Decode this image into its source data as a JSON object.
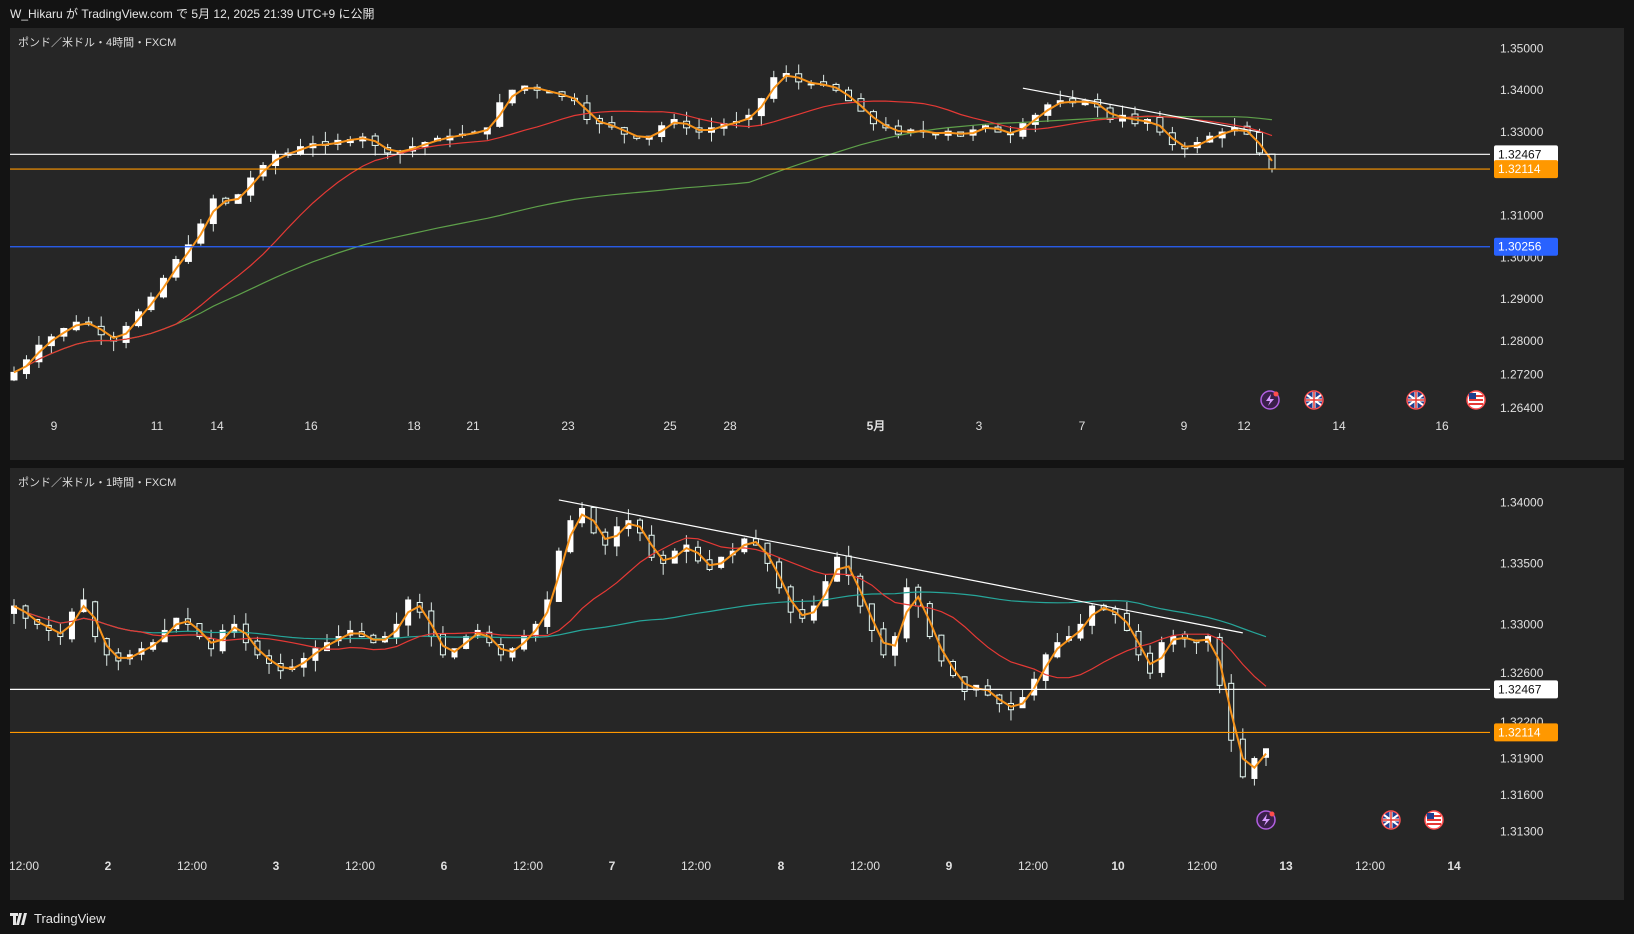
{
  "header": {
    "text": "W_Hikaru が TradingView.com で 5月 12, 2025 21:39 UTC+9 に公開"
  },
  "footer": {
    "brand": "TradingView"
  },
  "colors": {
    "pane_bg": "#262626",
    "candle_up": "#ffffff",
    "candle_down": "#e8fcf6",
    "ma_short": "#f7931a",
    "ma_mid": "#e53935",
    "ma_long_4h": "#5ea04a",
    "ma_long_1h": "#26a69a",
    "resistance": "#ffffff",
    "support_white": "#ffffff",
    "support_orange": "#ff9800",
    "support_blue": "#2962ff",
    "trendline": "#ffffff"
  },
  "panes": [
    {
      "id": "4h",
      "title": "ポンド／米ドル・4時間・FXCM",
      "chart_data": {
        "type": "candlestick",
        "instrument": "GBP/USD",
        "timeframe": "4h",
        "y_ticks": [
          "1.35000",
          "1.34000",
          "1.33000",
          "1.32000",
          "1.31000",
          "1.30000",
          "1.29000",
          "1.28000",
          "1.27200",
          "1.26400"
        ],
        "x_ticks": [
          "9",
          "11",
          "14",
          "16",
          "18",
          "21",
          "23",
          "25",
          "28",
          "5月",
          "3",
          "7",
          "9",
          "12",
          "14",
          "16"
        ],
        "ylim": [
          1.2635,
          1.3525
        ],
        "close_path": [
          1.2725,
          1.2755,
          1.279,
          1.281,
          1.283,
          1.2845,
          1.284,
          1.2815,
          1.28,
          1.2835,
          1.287,
          1.2905,
          1.295,
          1.2995,
          1.303,
          1.308,
          1.314,
          1.313,
          1.315,
          1.319,
          1.322,
          1.3245,
          1.325,
          1.3265,
          1.3272,
          1.3268,
          1.328,
          1.3282,
          1.3288,
          1.3268,
          1.325,
          1.3255,
          1.3265,
          1.3275,
          1.3285,
          1.329,
          1.3295,
          1.33,
          1.331,
          1.337,
          1.34,
          1.341,
          1.34,
          1.3395,
          1.3385,
          1.3375,
          1.333,
          1.332,
          1.3312,
          1.3295,
          1.3285,
          1.329,
          1.3315,
          1.333,
          1.331,
          1.33,
          1.331,
          1.332,
          1.3325,
          1.334,
          1.338,
          1.343,
          1.344,
          1.342,
          1.3415,
          1.3412,
          1.34,
          1.3375,
          1.335,
          1.332,
          1.331,
          1.3295,
          1.3305,
          1.33,
          1.3295,
          1.3302,
          1.329,
          1.3305,
          1.3315,
          1.33,
          1.3295,
          1.332,
          1.334,
          1.3365,
          1.3375,
          1.337,
          1.3375,
          1.336,
          1.333,
          1.334,
          1.332,
          1.333,
          1.33,
          1.327,
          1.326,
          1.3275,
          1.329,
          1.33,
          1.331,
          1.3295,
          1.325,
          1.3212
        ],
        "levels": [
          {
            "label": "1.32467",
            "value": 1.32467,
            "style": "white"
          },
          {
            "label": "1.32114",
            "value": 1.32114,
            "style": "orange"
          },
          {
            "label": "1.30256",
            "value": 1.30256,
            "style": "blue"
          }
        ],
        "trendline": {
          "from": [
            1.3405,
            1.3402
          ],
          "to": [
            1.3305,
            1.33
          ]
        },
        "events": [
          {
            "icon": "lightning-icon"
          },
          {
            "icon": "uk-flag-icon"
          },
          {
            "icon": "uk-flag-icon"
          },
          {
            "icon": "us-flag-icon"
          }
        ]
      }
    },
    {
      "id": "1h",
      "title": "ポンド／米ドル・1時間・FXCM",
      "chart_data": {
        "type": "candlestick",
        "instrument": "GBP/USD",
        "timeframe": "1h",
        "y_ticks": [
          "1.34000",
          "1.33500",
          "1.33000",
          "1.32600",
          "1.32200",
          "1.31900",
          "1.31600",
          "1.31300"
        ],
        "x_ticks": [
          "12:00",
          "2",
          "12:00",
          "3",
          "12:00",
          "6",
          "12:00",
          "7",
          "12:00",
          "8",
          "12:00",
          "9",
          "12:00",
          "10",
          "12:00",
          "13",
          "12:00",
          "14"
        ],
        "ylim": [
          1.3115,
          1.342
        ],
        "close_path": [
          1.3315,
          1.3305,
          1.33,
          1.3295,
          1.329,
          1.331,
          1.332,
          1.329,
          1.3275,
          1.327,
          1.3275,
          1.328,
          1.3285,
          1.3295,
          1.3305,
          1.33,
          1.329,
          1.328,
          1.3295,
          1.33,
          1.3285,
          1.3275,
          1.3268,
          1.3262,
          1.3265,
          1.3272,
          1.328,
          1.3285,
          1.329,
          1.3295,
          1.329,
          1.3285,
          1.329,
          1.33,
          1.332,
          1.331,
          1.329,
          1.3275,
          1.328,
          1.329,
          1.3295,
          1.3285,
          1.3275,
          1.328,
          1.329,
          1.33,
          1.332,
          1.336,
          1.3385,
          1.3395,
          1.3375,
          1.3365,
          1.338,
          1.3385,
          1.3375,
          1.3355,
          1.335,
          1.336,
          1.3365,
          1.3352,
          1.3345,
          1.3355,
          1.336,
          1.337,
          1.3365,
          1.335,
          1.333,
          1.331,
          1.3305,
          1.3315,
          1.3335,
          1.3355,
          1.334,
          1.3315,
          1.3295,
          1.3275,
          1.329,
          1.333,
          1.3315,
          1.329,
          1.327,
          1.3258,
          1.3245,
          1.325,
          1.3242,
          1.3235,
          1.323,
          1.324,
          1.3255,
          1.3275,
          1.3285,
          1.329,
          1.33,
          1.3315,
          1.3312,
          1.3308,
          1.3295,
          1.3275,
          1.326,
          1.3285,
          1.329,
          1.3288,
          1.3285,
          1.329,
          1.325,
          1.3205,
          1.3175,
          1.319,
          1.3198
        ],
        "levels": [
          {
            "label": "1.32467",
            "value": 1.32467,
            "style": "white"
          },
          {
            "label": "1.32114",
            "value": 1.32114,
            "style": "orange"
          }
        ],
        "trendline": {
          "from": [
            1.3402,
            1.34
          ],
          "to": [
            1.3295,
            1.3293
          ]
        },
        "events": [
          {
            "icon": "lightning-icon"
          },
          {
            "icon": "uk-flag-icon"
          },
          {
            "icon": "us-flag-icon"
          }
        ]
      }
    }
  ]
}
